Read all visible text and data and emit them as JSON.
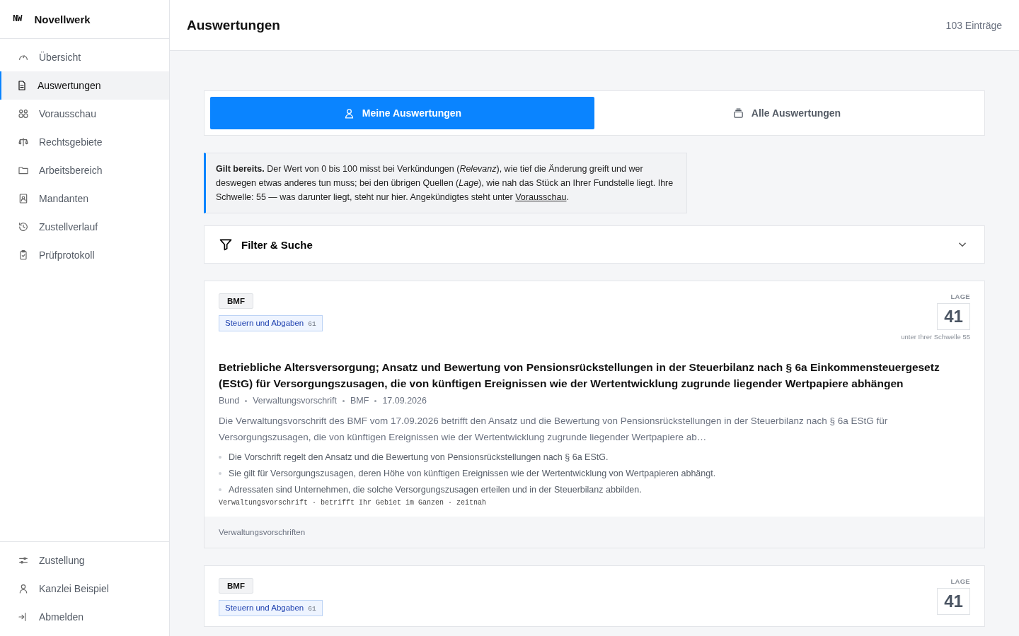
{
  "brand": {
    "logo": "NW",
    "name": "Novellwerk"
  },
  "nav": [
    {
      "label": "Übersicht",
      "selected": false
    },
    {
      "label": "Auswertungen",
      "selected": true
    },
    {
      "label": "Vorausschau",
      "selected": false
    },
    {
      "label": "Rechtsgebiete",
      "selected": false
    },
    {
      "label": "Arbeitsbereich",
      "selected": false
    },
    {
      "label": "Mandanten",
      "selected": false
    },
    {
      "label": "Zustellverlauf",
      "selected": false
    },
    {
      "label": "Prüfprotokoll",
      "selected": false
    }
  ],
  "nav_bottom": [
    {
      "label": "Zustellung"
    },
    {
      "label": "Kanzlei Beispiel"
    },
    {
      "label": "Abmelden"
    }
  ],
  "header": {
    "title": "Auswertungen",
    "count": "103 Einträge"
  },
  "tabs": [
    {
      "label": "Meine Auswertungen",
      "selected": true
    },
    {
      "label": "Alle Auswertungen",
      "selected": false
    }
  ],
  "info": {
    "text": "**Gilt bereits.** Der Wert von 0 bis 100 misst bei Verkündungen (*Relevanz*), wie tief die Änderung greift und wer deswegen etwas anderes tun muss; bei den übrigen Quellen (*Lage*), wie nah das Stück an Ihrer Fundstelle liegt. Ihre Schwelle: 55 — was darunter liegt, steht nur hier. Angekündigtes steht unter ",
    "link": "Vorausschau",
    "after": "."
  },
  "filter": {
    "label": "Filter & Suche",
    "expanded": false
  },
  "cards": [
    {
      "source": "BMF",
      "tag": "Steuern und Abgaben",
      "tag_count": "61",
      "score_label": "LAGE",
      "score": "41",
      "score_note": "unter Ihrer Schwelle 55",
      "title": "Betriebliche Altersversorgung; Ansatz und Bewertung von Pensionsrückstellungen in der Steuerbilanz nach § 6a Einkommensteuergesetz (EStG) für Versorgungszusagen, die von künftigen Ereignissen wie der Wertentwicklung zugrunde liegender Wertpapiere abhängen",
      "meta": [
        "Bund",
        "Verwaltungsvorschrift",
        "BMF",
        "17.09.2026"
      ],
      "summary": "Die Verwaltungsvorschrift des BMF vom 17.09.2026 betrifft den Ansatz und die Bewertung von Pensionsrückstellungen in der Steuerbilanz nach § 6a EStG für Versorgungszusagen, die von künftigen Ereignissen wie der Wertentwicklung zugrunde liegender Wertpapiere ab…",
      "bullets": [
        "Die Vorschrift regelt den Ansatz und die Bewertung von Pensionsrückstellungen nach § 6a EStG.",
        "Sie gilt für Versorgungszusagen, deren Höhe von künftigen Ereignissen wie der Wertentwicklung von Wertpapieren abhängt.",
        "Adressaten sind Unternehmen, die solche Versorgungszusagen erteilen und in der Steuerbilanz abbilden."
      ],
      "classification": "Verwaltungsvorschrift · betrifft Ihr Gebiet im Ganzen · zeitnah",
      "footer": "Verwaltungsvorschriften"
    },
    {
      "source": "BMF",
      "tag": "Steuern und Abgaben",
      "tag_count": "61",
      "score_label": "LAGE",
      "score": "41"
    }
  ]
}
